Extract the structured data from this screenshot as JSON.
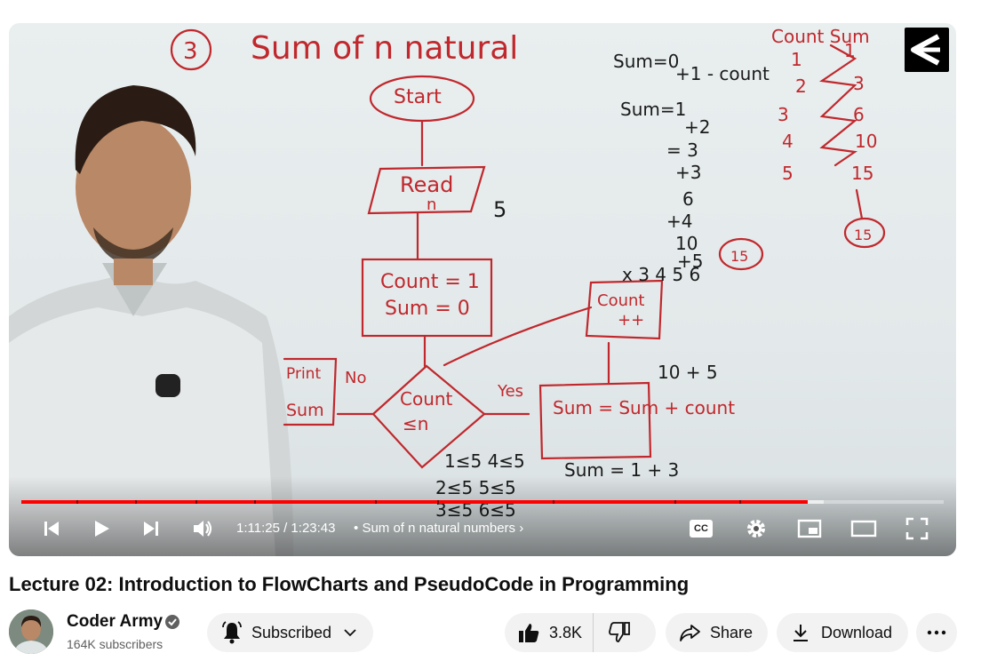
{
  "player": {
    "time_display": "1:11:25 / 1:23:43",
    "chapter_separator": "•",
    "chapter_title": "Sum of n natural numbers",
    "progress_played": 0.853,
    "progress_buffered": 0.87,
    "cc_label": "CC"
  },
  "board": {
    "heading_number": "3",
    "heading": "Sum of n natural",
    "start": "Start",
    "read": "Read",
    "read_var": "n",
    "input_val": "5",
    "init_line1": "Count = 1",
    "init_line2": "Sum = 0",
    "cond_line1": "Count",
    "cond_line2": "≤n",
    "yes": "Yes",
    "no": "No",
    "process": "Sum = Sum + count",
    "increment_line1": "Count",
    "increment_line2": "++",
    "print_line1": "Print",
    "print_line2": "Sum",
    "trace_header": "Count  Sum"
  },
  "video": {
    "title": "Lecture 02: Introduction to FlowCharts and PseudoCode in Programming"
  },
  "channel": {
    "name": "Coder Army",
    "subscribers": "164K subscribers"
  },
  "actions": {
    "subscribed_label": "Subscribed",
    "like_count": "3.8K",
    "share_label": "Share",
    "download_label": "Download"
  },
  "colors": {
    "progress_red": "#ff0000",
    "marker_red": "#c0282d",
    "pill_bg": "#f2f2f2"
  }
}
